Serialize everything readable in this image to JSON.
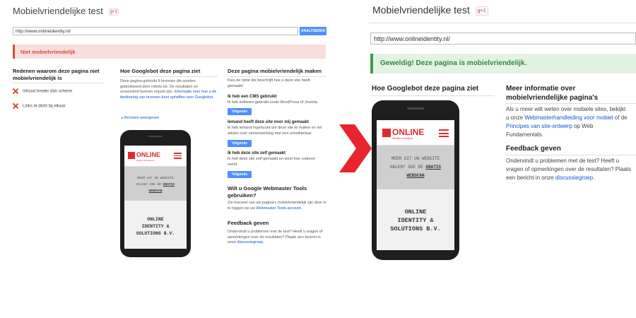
{
  "left": {
    "title": "Mobielvriendelijke test",
    "gplus": "g+1",
    "url_value": "http://www.onlineidentity.nl/",
    "analyze_label": "ANALYSEREN",
    "alert": "Niet mobielvriendelijk",
    "reasons": {
      "title": "Redenen waarom deze pagina niet mobielvriendelijk is",
      "items": [
        "Inhoud breder dan scherm",
        "Links te dicht bij elkaar"
      ]
    },
    "googlebot": {
      "title": "Hoe Googlebot deze pagina ziet",
      "text": "Deze pagina gebruikt 9 bronnen die worden geblokkeerd door robots.txt. De resultaten en screenshot kunnen onjuist zijn.",
      "link": "Informatie over hoe u de blokkering van bronnen kunt opheffen voor Googlebot.",
      "resources": "Bronnen weergeven"
    },
    "make": {
      "title": "Deze pagina mobielvriendelijk maken",
      "intro": "Kies de optie die beschrijft hoe u deze site heeft gemaakt:",
      "options": [
        {
          "title": "Ik heb een CMS gebruikt",
          "text": "Ik heb software gebruikt zoals WordPress of Joomla.",
          "button": "Volgende"
        },
        {
          "title": "Iemand heeft deze site voor mij gemaakt",
          "text": "Ik heb iemand ingehuurd om deze site te maken en wil advies over samenwerking met een ontwikkelaar.",
          "button": "Volgende"
        },
        {
          "title": "Ik heb deze site zelf gemaakt",
          "text": "Ik heb deze site zelf gemaakt en weet hoe coderen werkt.",
          "button": "Volgende"
        }
      ],
      "wmt_title": "Wilt u Google Webmaster Tools gebruiken?",
      "wmt_text": "Zie hoeveel van uw pagina's mobielvriendelijk zijn door in te loggen op uw",
      "wmt_link": "Webmaster Tools-account.",
      "feedback_title": "Feedback geven",
      "feedback_text": "Ondervindt u problemen met de test? Heeft u vragen of opmerkingen over de resultaten? Plaats een bericht in onze",
      "feedback_link": "discussiegroep."
    }
  },
  "right": {
    "title": "Mobielvriendelijke test",
    "gplus": "g+1",
    "url_value": "http://www.onlineidentity.nl/",
    "alert": "Geweldig! Deze pagina is mobielvriendelijk.",
    "googlebot_title": "Hoe Googlebot deze pagina ziet",
    "more_title": "Meer informatie over mobielvriendelijke pagina's",
    "more_text_1": "Als u meer wilt weten over mobiele sites, bekijkt u onze",
    "more_link_1": "Webmasterhandleiding voor mobiel",
    "more_text_2": "of de",
    "more_link_2": "Principes van site-ontwerp",
    "more_text_3": "op Web Fundamentals.",
    "feedback_title": "Feedback geven",
    "feedback_text": "Ondervindt u problemen met de test? Heeft u vragen of opmerkingen over de resultaten? Plaats een bericht in onze",
    "feedback_link": "discussiegroep."
  },
  "phone": {
    "logo_word": "ONLINE",
    "logo_tagline": "identity & solutions",
    "band_line1": "MEER UIT UW WEBSITE",
    "band_line2": "HALEN? DOE DE",
    "band_bold": "GRATIS",
    "band_line3": "WEBSCAN",
    "company_line1": "ONLINE",
    "company_line2": "IDENTITY &",
    "company_line3": "SOLUTIONS B.V."
  },
  "colors": {
    "accent_red": "#dd2b2b",
    "accent_blue": "#4d90fe",
    "success_green": "#3c9d4e",
    "error_red": "#dd4b39"
  }
}
